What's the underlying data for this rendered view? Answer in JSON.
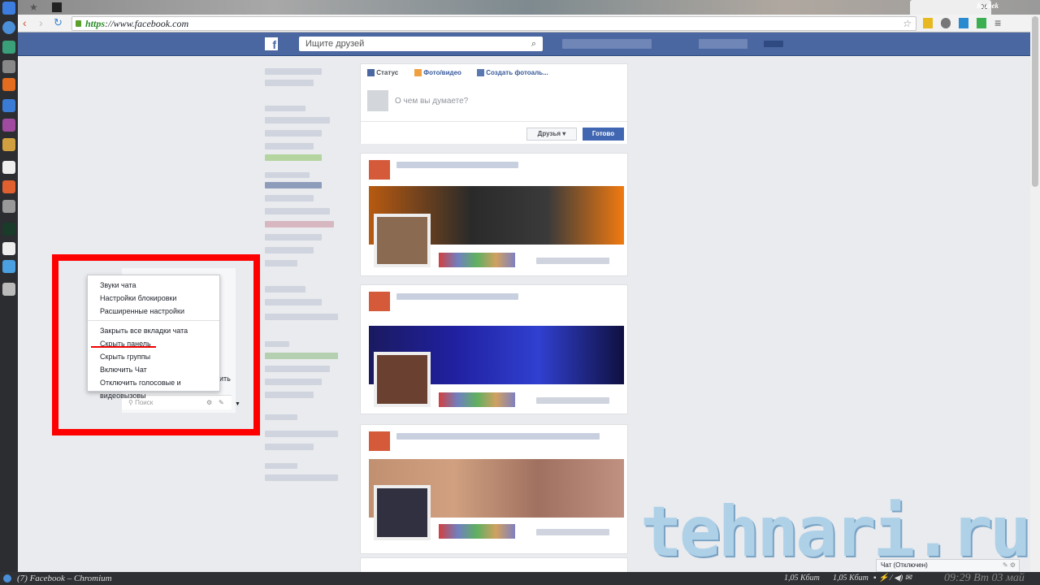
{
  "browser": {
    "url_scheme": "https",
    "url_rest": "://www.facebook.com",
    "window_user": "Kazbek"
  },
  "facebook": {
    "search_placeholder": "Ищите друзей",
    "composer": {
      "tabs": [
        "Статус",
        "Фото/видео",
        "Создать фотоаль..."
      ],
      "placeholder": "О чем вы думаете?",
      "audience": "Друзья",
      "submit": "Готово"
    },
    "chat_menu": {
      "items": [
        "Звуки чата",
        "Настройки блокировки",
        "Расширенные настройки",
        "Закрыть все вкладки чата",
        "Скрыть панель",
        "Скрыть группы",
        "Включить Чат",
        "Отключить голосовые и видеовызовы"
      ]
    },
    "chat_search_placeholder": "Поиск",
    "chat_partial": "ить",
    "chat_status": "Чат (Отключен)"
  },
  "watermark": "tehnari.ru",
  "taskbar": {
    "window_title": "(7) Facebook – Chromium",
    "net_down": "1,05 Кбит",
    "net_up": "1,05 Кбит",
    "clock": "09:29 Вт 03 май"
  },
  "colors": {
    "fb_blue": "#4b67a1",
    "highlight": "#ff0000"
  }
}
